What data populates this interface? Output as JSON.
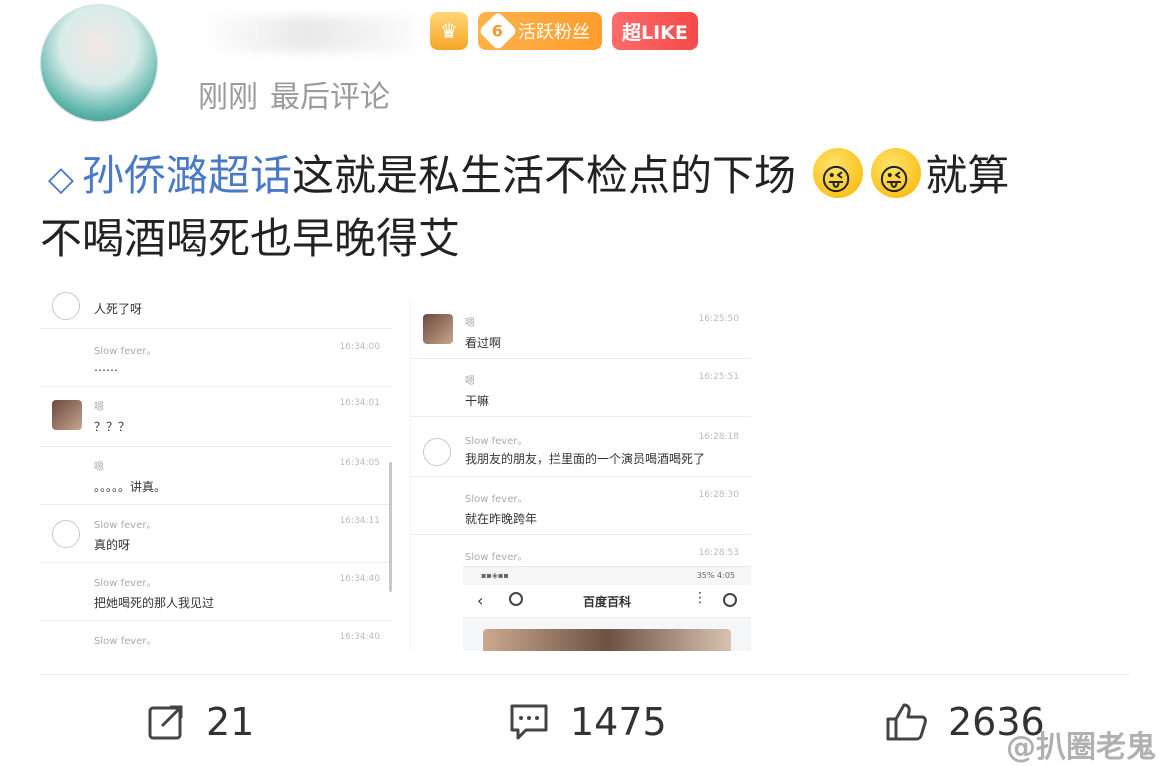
{
  "post": {
    "time": "刚刚",
    "last_comment": "最后评论",
    "badges": {
      "fan_level": "6",
      "fan_label": "活跃粉丝",
      "like_label": "超LIKE"
    },
    "topic": "孙侨潞超话",
    "text_part1": "这就是私生活不检点的下场",
    "text_part2": "就算",
    "text_part3": "不喝酒喝死也早晚得艾"
  },
  "screenshot_left": {
    "messages": [
      {
        "name": "",
        "text": "人死了呀",
        "time": ""
      },
      {
        "name": "Slow fever。",
        "text": "……",
        "time": "16:34:00"
      },
      {
        "name": "嗯",
        "text": "？？？",
        "time": "16:34:01"
      },
      {
        "name": "嗯",
        "text": "。。。。。讲真。",
        "time": "16:34:05"
      },
      {
        "name": "Slow fever。",
        "text": "真的呀",
        "time": "16:34:11"
      },
      {
        "name": "Slow fever。",
        "text": "把她喝死的那人我见过",
        "time": "16:34:40"
      },
      {
        "name": "Slow fever。",
        "text": "",
        "time": "16:34:40"
      }
    ]
  },
  "screenshot_right": {
    "messages": [
      {
        "name": "嗯",
        "text": "看过啊",
        "time": "16:25:50"
      },
      {
        "name": "嗯",
        "text": "干嘛",
        "time": "16:25:51"
      },
      {
        "name": "Slow fever。",
        "text": "我朋友的朋友，拦里面的一个演员喝酒喝死了",
        "time": "16:28:18"
      },
      {
        "name": "Slow fever。",
        "text": "就在昨晚跨年",
        "time": "16:28:30"
      },
      {
        "name": "Slow fever。",
        "text": "",
        "time": "16:28:53"
      }
    ],
    "browser": {
      "status_right": "35% 4:05",
      "title": "百度百科"
    }
  },
  "actions": {
    "share_count": "21",
    "comment_count": "1475",
    "like_count": "2636"
  },
  "watermark": "@扒圈老鬼",
  "colors": {
    "topic_blue": "#4a79c8",
    "fan_badge": "#ff9d2e",
    "like_badge": "#f34a4a",
    "meta_gray": "#9b9b9b"
  }
}
